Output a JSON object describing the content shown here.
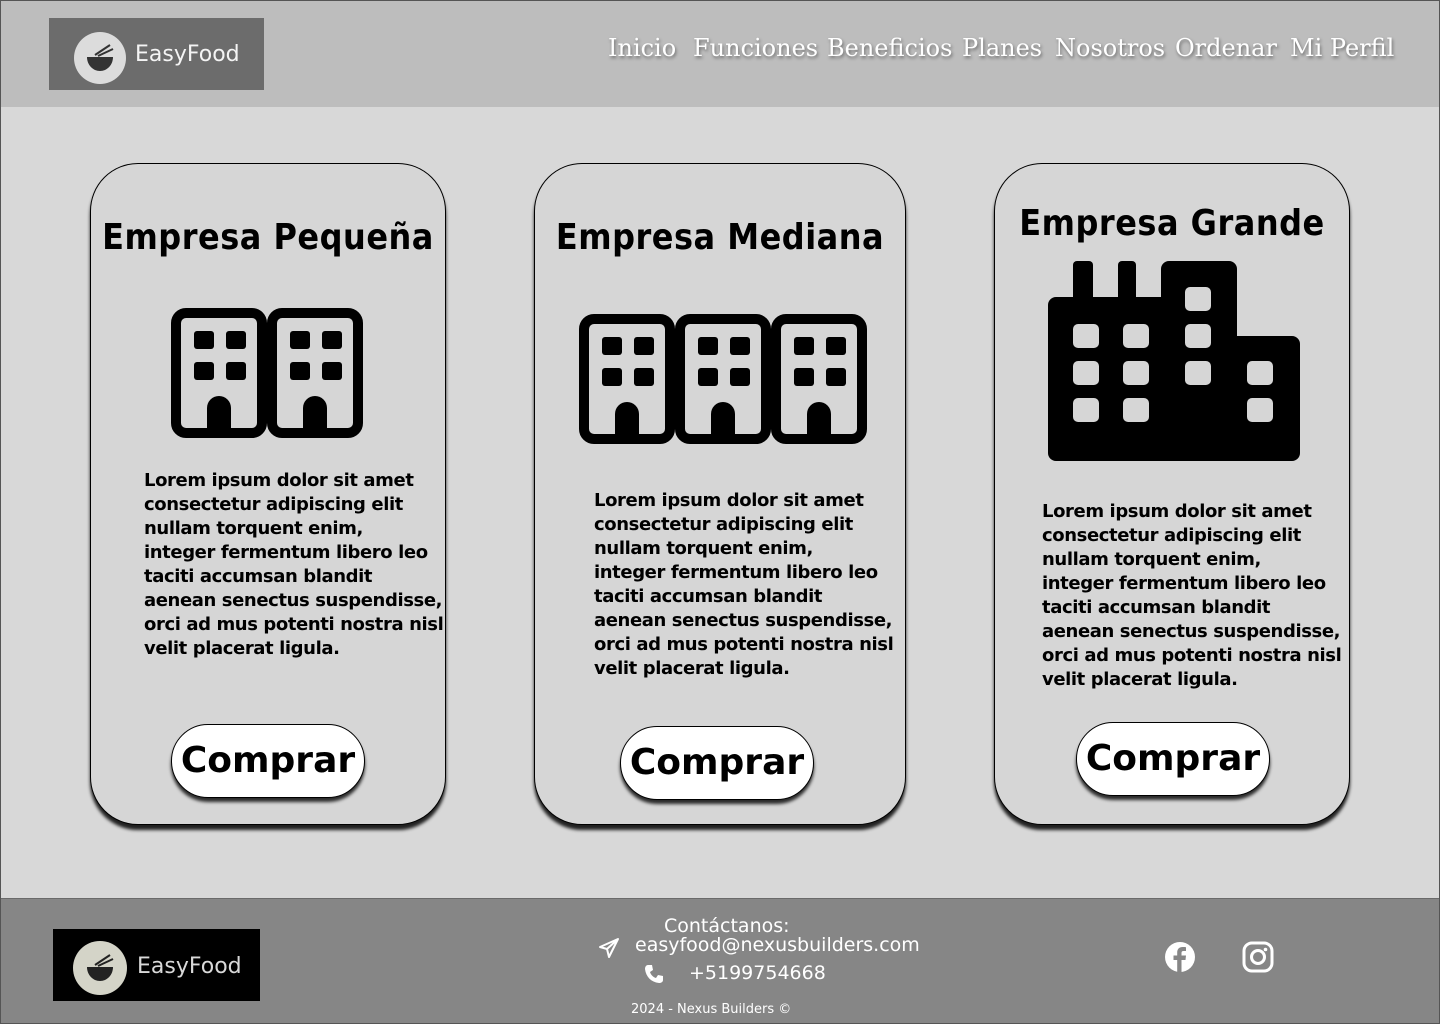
{
  "header": {
    "logo_text": "EasyFood",
    "nav": [
      "Inicio",
      "Funciones",
      "Beneficios",
      "Planes",
      "Nosotros",
      "Ordenar",
      "Mi Perfil"
    ]
  },
  "plans": [
    {
      "title": "Empresa Pequeña",
      "icon": "two-buildings-icon",
      "description": "Lorem ipsum dolor sit amet\nconsectetur adipiscing elit\nnullam torquent enim,\ninteger fermentum libero leo\ntaciti accumsan blandit\naenean senectus suspendisse,\norci ad mus potenti nostra nisl\nvelit placerat ligula.",
      "button": "Comprar"
    },
    {
      "title": "Empresa Mediana",
      "icon": "three-buildings-icon",
      "description": "Lorem ipsum dolor sit amet\nconsectetur adipiscing elit\nnullam torquent enim,\ninteger fermentum libero leo\ntaciti accumsan blandit\naenean senectus suspendisse,\norci ad mus potenti nostra nisl\nvelit placerat ligula.",
      "button": "Comprar"
    },
    {
      "title": "Empresa Grande",
      "icon": "factory-icon",
      "description": "Lorem ipsum dolor sit amet\nconsectetur adipiscing elit\nnullam torquent enim,\ninteger fermentum libero leo\ntaciti accumsan blandit\naenean senectus suspendisse,\norci ad mus potenti nostra nisl\nvelit placerat ligula.",
      "button": "Comprar"
    }
  ],
  "footer": {
    "logo_text": "EasyFood",
    "contact_title": "Contáctanos:",
    "email": "easyfood@nexusbuilders.com",
    "phone": "+5199754668",
    "copyright": "2024 - Nexus Builders ©",
    "social": [
      "facebook-icon",
      "instagram-icon"
    ]
  },
  "colors": {
    "header_bg": "#bdbdbd",
    "page_bg": "#d8d8d8",
    "footer_bg": "#868686",
    "logo_box_bg": "#6c6c6c"
  }
}
